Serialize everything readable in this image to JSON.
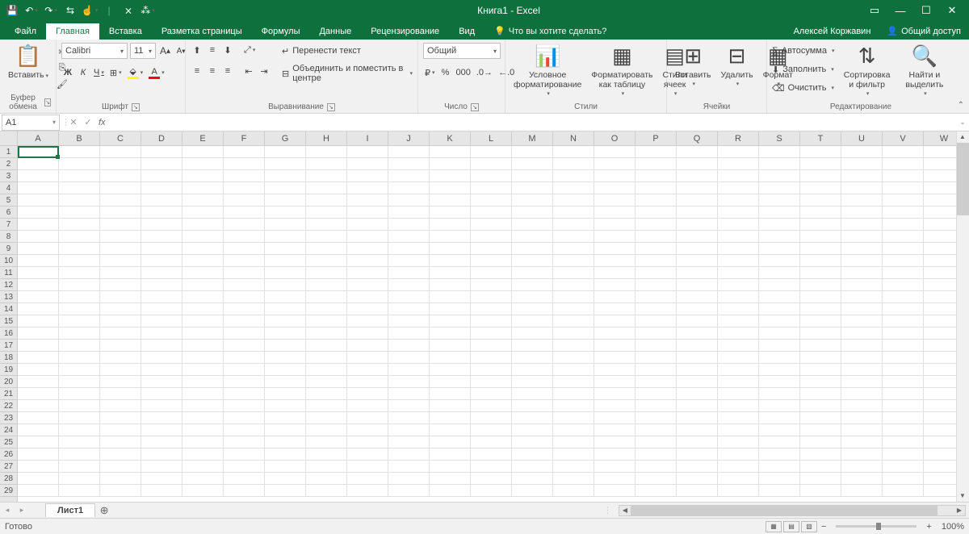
{
  "title": "Книга1 - Excel",
  "qat": [
    "save-icon",
    "undo-icon",
    "redo-icon",
    "quick-access-icon",
    "touch-mode-icon",
    "divider",
    "clear-icon",
    "macros-icon"
  ],
  "window_controls": {
    "ribbon_options": "▭",
    "minimize": "—",
    "maximize": "☐",
    "close": "✕"
  },
  "tabs": {
    "file": "Файл",
    "home": "Главная",
    "insert": "Вставка",
    "page_layout": "Разметка страницы",
    "formulas": "Формулы",
    "data": "Данные",
    "review": "Рецензирование",
    "view": "Вид"
  },
  "tellme": "Что вы хотите сделать?",
  "user": "Алексей Коржавин",
  "share": "Общий доступ",
  "ribbon": {
    "clipboard": {
      "label": "Буфер обмена",
      "paste": "Вставить"
    },
    "font": {
      "label": "Шрифт",
      "name": "Calibri",
      "size": "11",
      "increase": "A",
      "decrease": "A",
      "bold": "Ж",
      "italic": "К",
      "underline": "Ч"
    },
    "alignment": {
      "label": "Выравнивание",
      "wrap": "Перенести текст",
      "merge": "Объединить и поместить в центре"
    },
    "number": {
      "label": "Число",
      "format": "Общий",
      "percent": "%",
      "comma": "000"
    },
    "styles": {
      "label": "Стили",
      "conditional": "Условное форматирование",
      "table": "Форматировать как таблицу",
      "cell": "Стили ячеек"
    },
    "cells": {
      "label": "Ячейки",
      "insert": "Вставить",
      "delete": "Удалить",
      "format": "Формат"
    },
    "editing": {
      "label": "Редактирование",
      "autosum": "Автосумма",
      "fill": "Заполнить",
      "clear": "Очистить",
      "sort": "Сортировка и фильтр",
      "find": "Найти и выделить"
    }
  },
  "formula_bar": {
    "namebox": "A1",
    "fx": "fx",
    "value": ""
  },
  "columns": [
    "A",
    "B",
    "C",
    "D",
    "E",
    "F",
    "G",
    "H",
    "I",
    "J",
    "K",
    "L",
    "M",
    "N",
    "O",
    "P",
    "Q",
    "R",
    "S",
    "T",
    "U",
    "V",
    "W"
  ],
  "row_count": 29,
  "sheet": {
    "tab": "Лист1",
    "new": "⊕"
  },
  "status": {
    "ready": "Готово",
    "zoom": "100%"
  }
}
